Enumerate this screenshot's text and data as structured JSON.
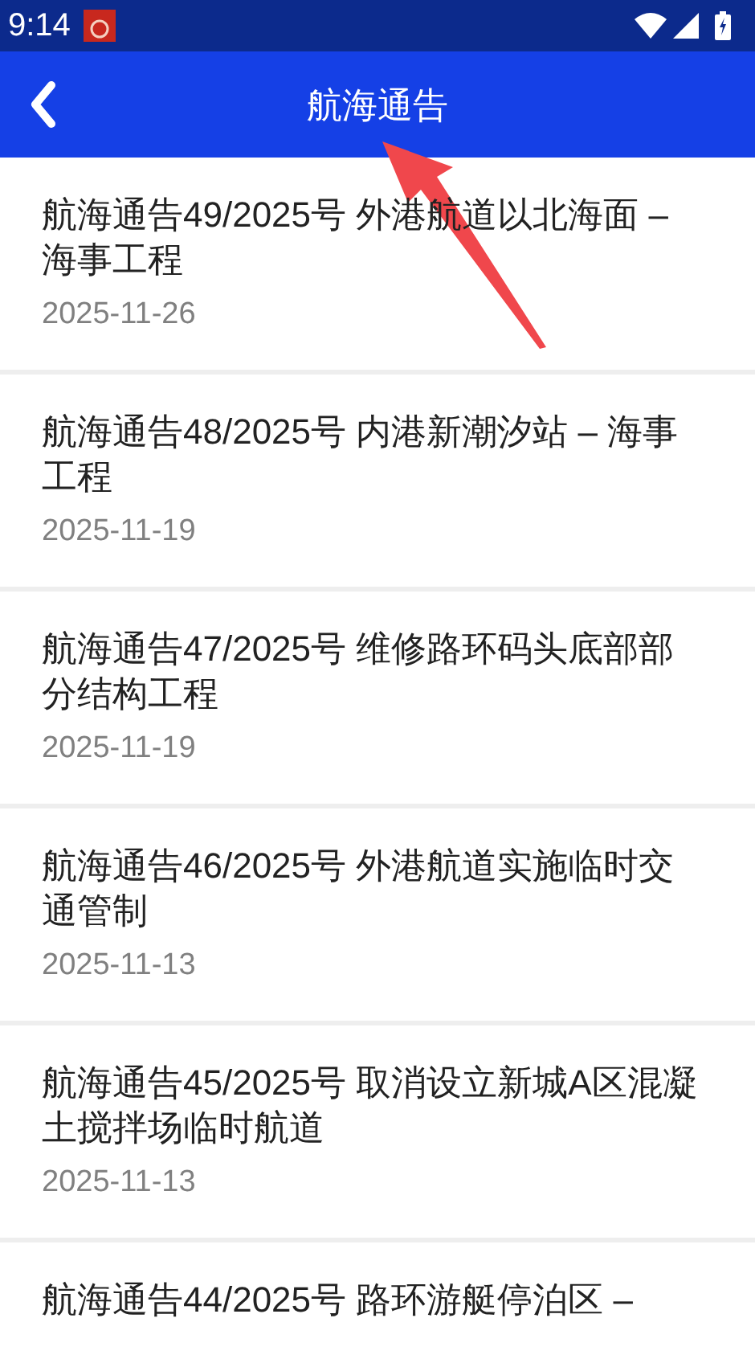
{
  "status_bar": {
    "time": "9:14"
  },
  "app_bar": {
    "title": "航海通告"
  },
  "notices": [
    {
      "title": "航海通告49/2025号 外港航道以北海面 – 海事工程",
      "date": "2025-11-26"
    },
    {
      "title": "航海通告48/2025号 内港新潮汐站 – 海事工程",
      "date": "2025-11-19"
    },
    {
      "title": "航海通告47/2025号 维修路环码头底部部分结构工程",
      "date": "2025-11-19"
    },
    {
      "title": "航海通告46/2025号 外港航道实施临时交通管制",
      "date": "2025-11-13"
    },
    {
      "title": "航海通告45/2025号 取消设立新城A区混凝土搅拌场临时航道",
      "date": "2025-11-13"
    },
    {
      "title": "航海通告44/2025号 路环游艇停泊区 –"
    }
  ]
}
